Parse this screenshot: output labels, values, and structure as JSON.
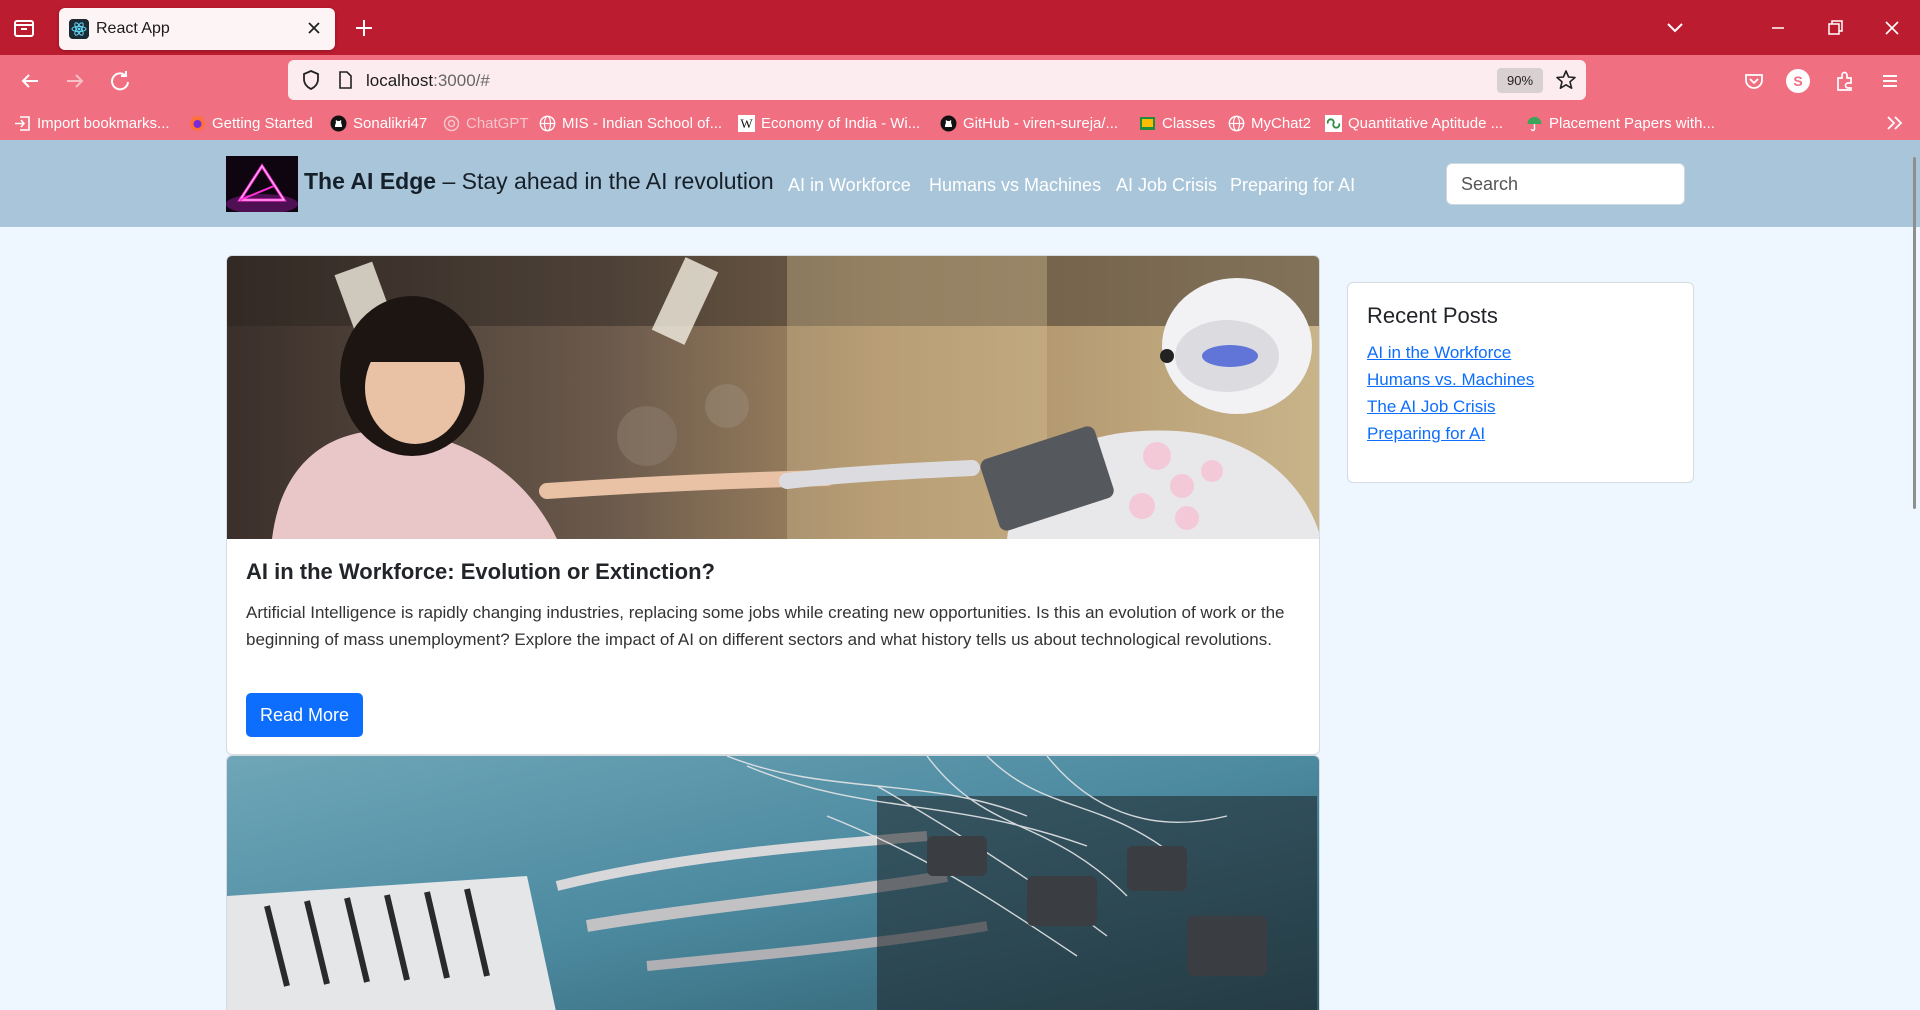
{
  "browser": {
    "tab_title": "React App",
    "url_host": "localhost",
    "url_rest": ":3000/#",
    "zoom": "90%",
    "profile_initial": "S",
    "bookmarks": [
      {
        "label": "Import bookmarks...",
        "icon": "import-icon"
      },
      {
        "label": "Getting Started",
        "icon": "firefox-icon"
      },
      {
        "label": "Sonalikri47",
        "icon": "github-icon"
      },
      {
        "label": "ChatGPT",
        "icon": "chatgpt-icon"
      },
      {
        "label": "MIS - Indian School of...",
        "icon": "globe-icon"
      },
      {
        "label": "Economy of India - Wi...",
        "icon": "wikipedia-icon"
      },
      {
        "label": "GitHub - viren-sureja/...",
        "icon": "github-icon"
      },
      {
        "label": "Classes",
        "icon": "classroom-icon"
      },
      {
        "label": "MyChat2",
        "icon": "globe-icon"
      },
      {
        "label": "Quantitative Aptitude ...",
        "icon": "geeksforgeeks-icon"
      },
      {
        "label": "Placement Papers with...",
        "icon": "umbrella-icon"
      }
    ]
  },
  "site": {
    "brand_name": "The AI Edge",
    "brand_tagline": " – Stay ahead in the AI revolution",
    "nav": [
      "AI in Workforce",
      "Humans vs Machines",
      "AI Job Crisis",
      "Preparing for AI"
    ],
    "search_placeholder": "Search"
  },
  "posts": [
    {
      "title": "AI in the Workforce: Evolution or Extinction?",
      "excerpt": "Artificial Intelligence is rapidly changing industries, replacing some jobs while creating new opportunities. Is this an evolution of work or the beginning of mass unemployment? Explore the impact of AI on different sectors and what history tells us about technological revolutions.",
      "button": "Read More"
    }
  ],
  "sidebar": {
    "heading": "Recent Posts",
    "links": [
      "AI in the Workforce",
      "Humans vs. Machines",
      "The AI Job Crisis",
      "Preparing for AI"
    ]
  },
  "colors": {
    "tabbar": "#bb1c2f",
    "toolbar": "#f06f80",
    "header": "#a9c5d9",
    "page_bg": "#eef6ff",
    "primary_button": "#0d6efd"
  }
}
